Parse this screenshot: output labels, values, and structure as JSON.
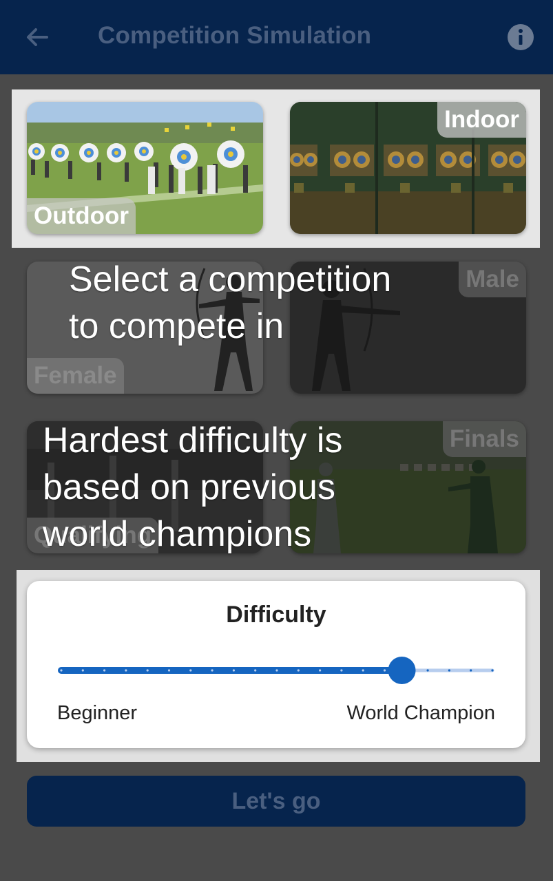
{
  "header": {
    "title": "Competition Simulation",
    "back_icon": "arrow-left-icon",
    "info_icon": "info-icon"
  },
  "venue": {
    "outdoor_label": "Outdoor",
    "indoor_label": "Indoor",
    "selected": "both"
  },
  "gender": {
    "female_label": "Female",
    "male_label": "Male"
  },
  "round": {
    "qualifying_label": "Qualifying",
    "finals_label": "Finals"
  },
  "tutorial": {
    "line1": "Select a competition",
    "line2": "to compete in",
    "difficulty_line1": "Hardest difficulty is",
    "difficulty_line2": "based on previous",
    "difficulty_line3": "world champions"
  },
  "difficulty": {
    "title": "Difficulty",
    "min_label": "Beginner",
    "max_label": "World Champion",
    "value": 0.79,
    "steps": 20
  },
  "action": {
    "go_label": "Let's go"
  },
  "colors": {
    "primary": "#06244d",
    "accent": "#1565c0",
    "overlay": "#4a4a4a"
  }
}
